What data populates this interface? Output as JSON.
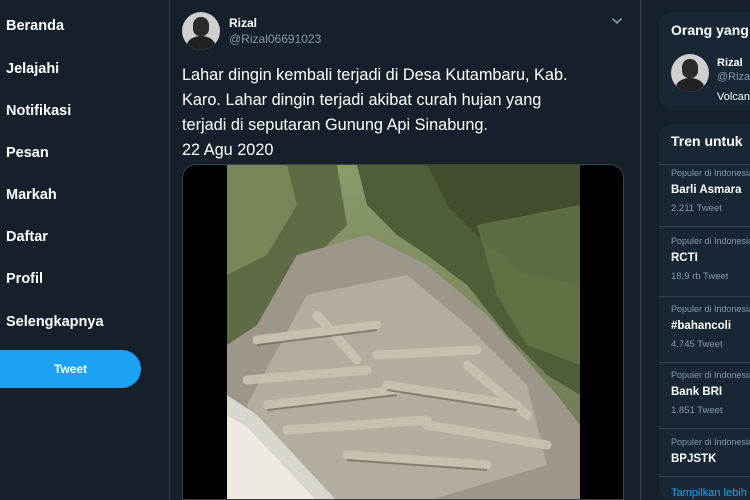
{
  "nav": {
    "items": [
      {
        "label": "Beranda"
      },
      {
        "label": "Jelajahi"
      },
      {
        "label": "Notifikasi"
      },
      {
        "label": "Pesan"
      },
      {
        "label": "Markah"
      },
      {
        "label": "Daftar"
      },
      {
        "label": "Profil"
      },
      {
        "label": "Selengkapnya"
      }
    ],
    "tweet_button": "Tweet"
  },
  "tweet": {
    "author_name": "Rizal",
    "author_handle": "@Rizal06691023",
    "text_lines": [
      "Lahar dingin kembali terjadi di Desa Kutambaru, Kab.",
      "Karo. Lahar dingin terjadi akibat curah hujan yang",
      "terjadi di seputaran Gunung Api Sinabung.",
      "22 Agu 2020"
    ],
    "more_icon": "chevron-down-icon"
  },
  "who_to_follow": {
    "title": "Orang yang",
    "user": {
      "name": "Rizal",
      "handle": "@Rizal",
      "bio": "Volcano"
    }
  },
  "trends": {
    "title": "Tren untuk",
    "items": [
      {
        "context": "Populer di Indonesia",
        "topic": "Barli Asmara",
        "count": "2.211 Tweet"
      },
      {
        "context": "Populer di Indonesia",
        "topic": "RCTI",
        "count": "18,9 rb Tweet"
      },
      {
        "context": "Populer di Indonesia",
        "topic": "#bahancoli",
        "count": "4.745 Tweet"
      },
      {
        "context": "Populer di Indonesia",
        "topic": "Bank BRI",
        "count": "1.851 Tweet"
      },
      {
        "context": "Populer di Indonesia",
        "topic": "BPJSTK",
        "count": ""
      }
    ],
    "show_more": "Tampilkan lebih"
  },
  "colors": {
    "background": "#15202b",
    "card": "#192734",
    "accent": "#1da1f2",
    "muted_text": "#8899a6",
    "border": "#38444d"
  }
}
